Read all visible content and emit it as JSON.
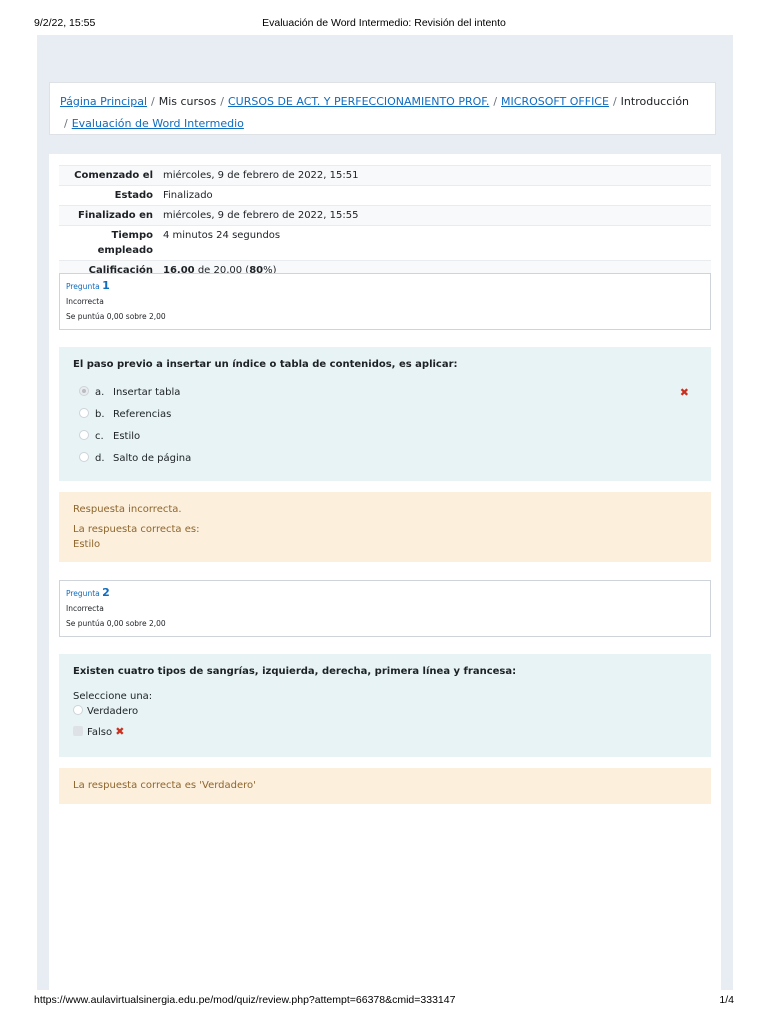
{
  "print": {
    "date": "9/2/22, 15:55",
    "title": "Evaluación de Word Intermedio: Revisión del intento",
    "url": "https://www.aulavirtualsinergia.edu.pe/mod/quiz/review.php?attempt=66378&cmid=333147",
    "pages": "1/4"
  },
  "breadcrumb": {
    "home": "Página Principal",
    "sep": "/",
    "my_courses": "Mis cursos",
    "category": "CURSOS DE ACT. Y PERFECCIONAMIENTO PROF.",
    "course": "MICROSOFT OFFICE",
    "section": "Introducción",
    "quiz": "Evaluación de Word Intermedio"
  },
  "summary": [
    {
      "label": "Comenzado el",
      "value": "miércoles, 9 de febrero de 2022, 15:51"
    },
    {
      "label": "Estado",
      "value": "Finalizado"
    },
    {
      "label": "Finalizado en",
      "value": "miércoles, 9 de febrero de 2022, 15:55"
    },
    {
      "label": "Tiempo empleado",
      "value": "4 minutos 24 segundos"
    },
    {
      "label": "Calificación",
      "value_bold": "16,00",
      "value_mid": " de 20,00 (",
      "value_pct": "80",
      "value_end": "%)"
    }
  ],
  "questions": [
    {
      "label": "Pregunta",
      "number": "1",
      "state": "Incorrecta",
      "mark": "Se puntúa 0,00 sobre 2,00",
      "text": "El paso previo a insertar un índice o tabla de contenidos, es aplicar:",
      "answers": [
        {
          "letter": "a.",
          "text": "Insertar tabla"
        },
        {
          "letter": "b.",
          "text": "Referencias"
        },
        {
          "letter": "c.",
          "text": "Estilo"
        },
        {
          "letter": "d.",
          "text": "Salto de página"
        }
      ],
      "feedback_title": "Respuesta incorrecta.",
      "feedback_intro": "La respuesta correcta es:",
      "feedback_answer": "Estilo"
    },
    {
      "label": "Pregunta",
      "number": "2",
      "state": "Incorrecta",
      "mark": "Se puntúa 0,00 sobre 2,00",
      "text": "Existen cuatro tipos de sangrías, izquierda, derecha, primera línea y francesa:",
      "prompt": "Seleccione una:",
      "answers": [
        {
          "text": "Verdadero"
        },
        {
          "text": "Falso"
        }
      ],
      "feedback": "La respuesta correcta es 'Verdadero'"
    }
  ],
  "icons": {
    "incorrect": "incorrect-x-icon",
    "incorrect_color": "#ca3120"
  }
}
